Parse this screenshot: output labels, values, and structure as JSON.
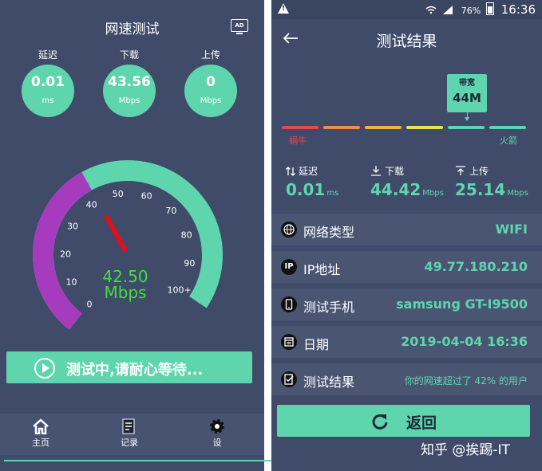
{
  "left": {
    "title": "网速测试",
    "ad_icon": {
      "name": "ad-icon",
      "text": "AD"
    },
    "metrics": [
      {
        "label": "延迟",
        "value": "0.01",
        "unit": "ms"
      },
      {
        "label": "下载",
        "value": "43.56",
        "unit": "Mbps"
      },
      {
        "label": "上传",
        "value": "0",
        "unit": "Mbps"
      }
    ],
    "gauge": {
      "ticks": [
        "0",
        "10",
        "20",
        "30",
        "40",
        "50",
        "60",
        "70",
        "80",
        "90",
        "100+"
      ],
      "current_value": 42.5,
      "reading": "42.50",
      "unit": "Mbps",
      "colors": {
        "track": "#5fd5ad",
        "fill": "#a63bbd",
        "needle": "#e0101a",
        "reading": "#3fe03f"
      }
    },
    "start_button": {
      "label": "测试中,请耐心等待..."
    },
    "nav": [
      {
        "label": "主页",
        "icon": "home-icon"
      },
      {
        "label": "记录",
        "icon": "record-icon"
      },
      {
        "label": "设",
        "icon": "settings-icon"
      }
    ]
  },
  "right": {
    "status_bar": {
      "battery": "76%",
      "time": "16:36",
      "icons": [
        "warning-icon",
        "wifi-icon",
        "signal-icon",
        "battery-icon"
      ]
    },
    "title": "测试结果",
    "bandwidth": {
      "label": "带宽",
      "value": "44M"
    },
    "scale": {
      "min_label": "蜗牛",
      "max_label": "火箭",
      "colors": [
        "#e24b4b",
        "#f08c4a",
        "#f2b33d",
        "#e8e34a",
        "#5fd5ad",
        "#5fd5ad"
      ]
    },
    "metrics": [
      {
        "label": "延迟",
        "value": "0.01",
        "unit": "ms",
        "icon": "updown-icon"
      },
      {
        "label": "下载",
        "value": "44.42",
        "unit": "Mbps",
        "icon": "download-icon"
      },
      {
        "label": "上传",
        "value": "25.14",
        "unit": "Mbps",
        "icon": "upload-icon"
      }
    ],
    "rows": [
      {
        "icon": "globe-icon",
        "label": "网络类型",
        "value": "WIFI"
      },
      {
        "icon": "ip-icon",
        "icon_text": "IP",
        "label": "IP地址",
        "value": "49.77.180.210"
      },
      {
        "icon": "phone-icon",
        "label": "测试手机",
        "value": "samsung GT-I9500"
      },
      {
        "icon": "calendar-icon",
        "label": "日期",
        "value": "2019-04-04 16:36"
      },
      {
        "icon": "result-icon",
        "label": "测试结果",
        "value": "你的网速超过了 42% 的用户"
      }
    ],
    "return_button": {
      "label": "返回"
    },
    "watermark": "知乎 @挨踢-IT"
  },
  "accent": "#5fd5ad",
  "background": "#3f4b69"
}
